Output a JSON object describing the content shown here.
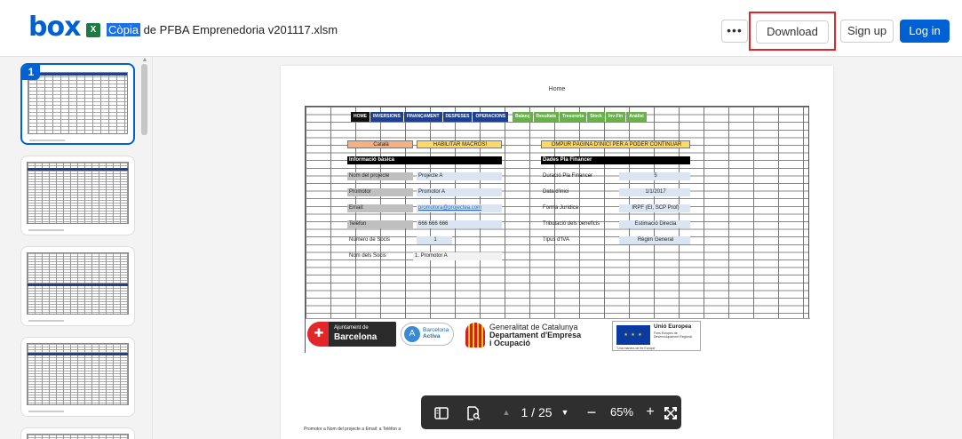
{
  "header": {
    "logo": "box",
    "file_icon_label": "X",
    "file_title_highlight": "Còpia",
    "file_title_rest": " de PFBA Emprenedoria v201117.xlsm",
    "more_label": "•••",
    "download_label": "Download",
    "signup_label": "Sign up",
    "login_label": "Log in",
    "accent_color": "#0061d5",
    "highlight_box_color": "#e2262a"
  },
  "sidebar": {
    "active_page": "1"
  },
  "document": {
    "page_header": "Home",
    "nav_buttons": [
      {
        "label": "HOME",
        "color": "#111111"
      },
      {
        "label": "INVERSIONS",
        "color": "#1f3f8f"
      },
      {
        "label": "FINANÇAMENT",
        "color": "#1f3f8f"
      },
      {
        "label": "DESPESES",
        "color": "#1f3f8f"
      },
      {
        "label": "OPERACIONS",
        "color": "#1f3f8f"
      },
      {
        "label": "Balanç",
        "color": "#6ab04c"
      },
      {
        "label": "Resultats",
        "color": "#6ab04c"
      },
      {
        "label": "Tresoreria",
        "color": "#6ab04c"
      },
      {
        "label": "Stock",
        "color": "#6ab04c"
      },
      {
        "label": "Inv-Fin",
        "color": "#6ab04c"
      },
      {
        "label": "Anàlisi",
        "color": "#6ab04c"
      }
    ],
    "catala": "Català",
    "habilitar_macros": "HABILITAR MACROS!",
    "omplir": "OMPUR PÀGINA D'INICI PER A PODER CONTINUAR",
    "info_basica": "Informació bàsica",
    "dades_pla": "Dades Pla Financer",
    "rows_left": [
      {
        "label": "Nom del projecte",
        "value": "Projecte A"
      },
      {
        "label": "Promotor",
        "value": "Promotor A"
      },
      {
        "label": "Email:",
        "value": "promotora@projectea.com"
      },
      {
        "label": "Telèfon",
        "value": "666 666 666"
      },
      {
        "label": "Número de Socis",
        "value": "1"
      },
      {
        "label": "Nom dels Socis",
        "value": "1. Promotor A"
      }
    ],
    "rows_right": [
      {
        "label": "Duració Pla Financer",
        "value": "5"
      },
      {
        "label": "Data d'inici",
        "value": "1/1/2017"
      },
      {
        "label": "Forma Jurídica",
        "value": "IRPF (EI, SCP Prof)"
      },
      {
        "label": "Tributació dels beneficis",
        "value": "Estimació Directa"
      },
      {
        "label": "Tipus d'IVA",
        "value": "Règim General"
      }
    ],
    "logos": {
      "ajuntament_line1": "Ajuntament de",
      "ajuntament_line2": "Barcelona",
      "barcelona_activa_1": "Barcelona",
      "barcelona_activa_2": "Activa",
      "generalitat_1": "Generalitat de Catalunya",
      "generalitat_2": "Departament d'Empresa",
      "generalitat_3": "i Ocupació",
      "eu_title": "Unió Europea",
      "eu_sub": "Fons Europeu de Desenvolupament Regional",
      "eu_motto": "\"Una manera de fer Europa\""
    },
    "page_footer": "Promotor a Nom del projecte a Email: a Telèfon a"
  },
  "toolbar": {
    "sidebar_icon": "sidebar-toggle-icon",
    "search_icon": "document-search-icon",
    "page_display": "1 / 25",
    "zoom": "65%",
    "minus": "−",
    "plus": "+"
  }
}
